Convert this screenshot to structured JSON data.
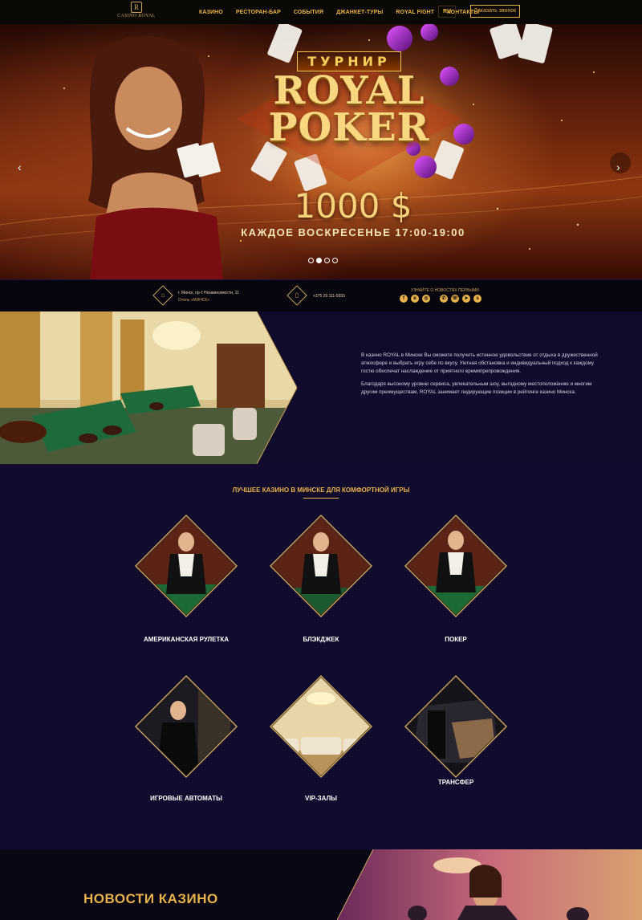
{
  "header": {
    "logo_text": "CASINO ROYAL",
    "nav": [
      "КАЗИНО",
      "РЕСТОРАН-БАР",
      "СОБЫТИЯ",
      "ДЖАНКЕТ-ТУРЫ",
      "ROYAL FIGHT",
      "КОНТАКТЫ"
    ],
    "lang": "RU",
    "call_button": "Заказать звонок"
  },
  "hero": {
    "badge": "ТУРНИР",
    "title_line1": "ROYAL",
    "title_line2": "POKER",
    "prize": "1000 $",
    "schedule": "КАЖДОЕ ВОСКРЕСЕНЬЕ 17:00-19:00",
    "slides": 4,
    "active_slide": 2
  },
  "info": {
    "address_line1": "г. Минск, пр-т Независимости, 11",
    "address_line2": "Отель «МИНСК»",
    "phone": "+375 29 111-5555",
    "social_title": "УЗНАЙТЕ О НОВОСТЯХ ПЕРВЫМИ"
  },
  "about": {
    "paragraph1": "В казино ROYAL в Минске Вы сможете получить истинное удовольствие от отдыха в дружественной атмосфере и выбрать игру себе по вкусу. Уютная обстановка и индивидуальный подход к каждому гостю обеспечат наслаждение от приятного времяпрепровождения.",
    "paragraph2": "Благодаря высокому уровню сервиса, увлекательным шоу, выгодному местоположению и многим другим преимуществам, ROYAL занимает лидирующие позиции в рейтинге казино Минска."
  },
  "games": {
    "title": "ЛУЧШЕЕ КАЗИНО В МИНСКЕ ДЛЯ КОМФОРТНОЙ ИГРЫ",
    "items": [
      {
        "label": "АМЕРИКАНСКАЯ РУЛЕТКА"
      },
      {
        "label": "БЛЭКДЖЕК"
      },
      {
        "label": "ПОКЕР"
      },
      {
        "label": "ИГРОВЫЕ АВТОМАТЫ"
      },
      {
        "label": "VIP-ЗАЛЫ"
      },
      {
        "label": "ТРАНСФЕР"
      }
    ]
  },
  "news": {
    "title": "НОВОСТИ КАЗИНО"
  },
  "colors": {
    "accent": "#e8b34a",
    "background": "#110c2e",
    "header_bg": "#0b0906"
  }
}
